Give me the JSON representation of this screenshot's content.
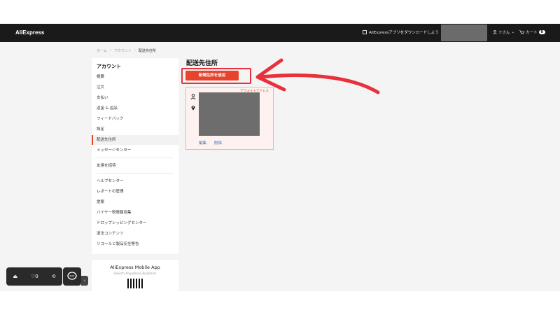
{
  "header": {
    "logo": "AliExpress",
    "app_download": "AliExpressアプリをダウンロードしよう",
    "account": "ナさん",
    "cart_label": "カート",
    "cart_count": "0"
  },
  "breadcrumb": [
    "ホーム",
    "アカウント",
    "配送先住所"
  ],
  "sidebar": {
    "title": "アカウント",
    "items": [
      {
        "label": "概要"
      },
      {
        "label": "注文"
      },
      {
        "label": "支払い"
      },
      {
        "label": "返金 & 返品"
      },
      {
        "label": "フィードバック"
      },
      {
        "label": "設定"
      },
      {
        "label": "配送先住所"
      },
      {
        "label": "メッセージセンター"
      },
      {
        "label": "友達を招待"
      },
      {
        "label": "ヘルプセンター"
      },
      {
        "label": "レポートの管理"
      },
      {
        "label": "提案"
      },
      {
        "label": "バイヤー税情報収集"
      },
      {
        "label": "ドロップシッピングセンター"
      },
      {
        "label": "違法コンテンツ"
      },
      {
        "label": "リコールと製品安全警告"
      }
    ]
  },
  "mobile_app": {
    "title": "AliExpress Mobile App",
    "subtitle": "Search Anywhere,Anytime!"
  },
  "main": {
    "title": "配送先住所",
    "add_button": "新規住所を追加",
    "default_tag": "デフォルトアドレス",
    "edit": "編集",
    "delete": "削除"
  },
  "float_bar": {
    "wishlist_count": "0"
  },
  "colors": {
    "accent": "#e8432b",
    "annotation": "#e8313a",
    "topbar": "#1a1a1a"
  }
}
